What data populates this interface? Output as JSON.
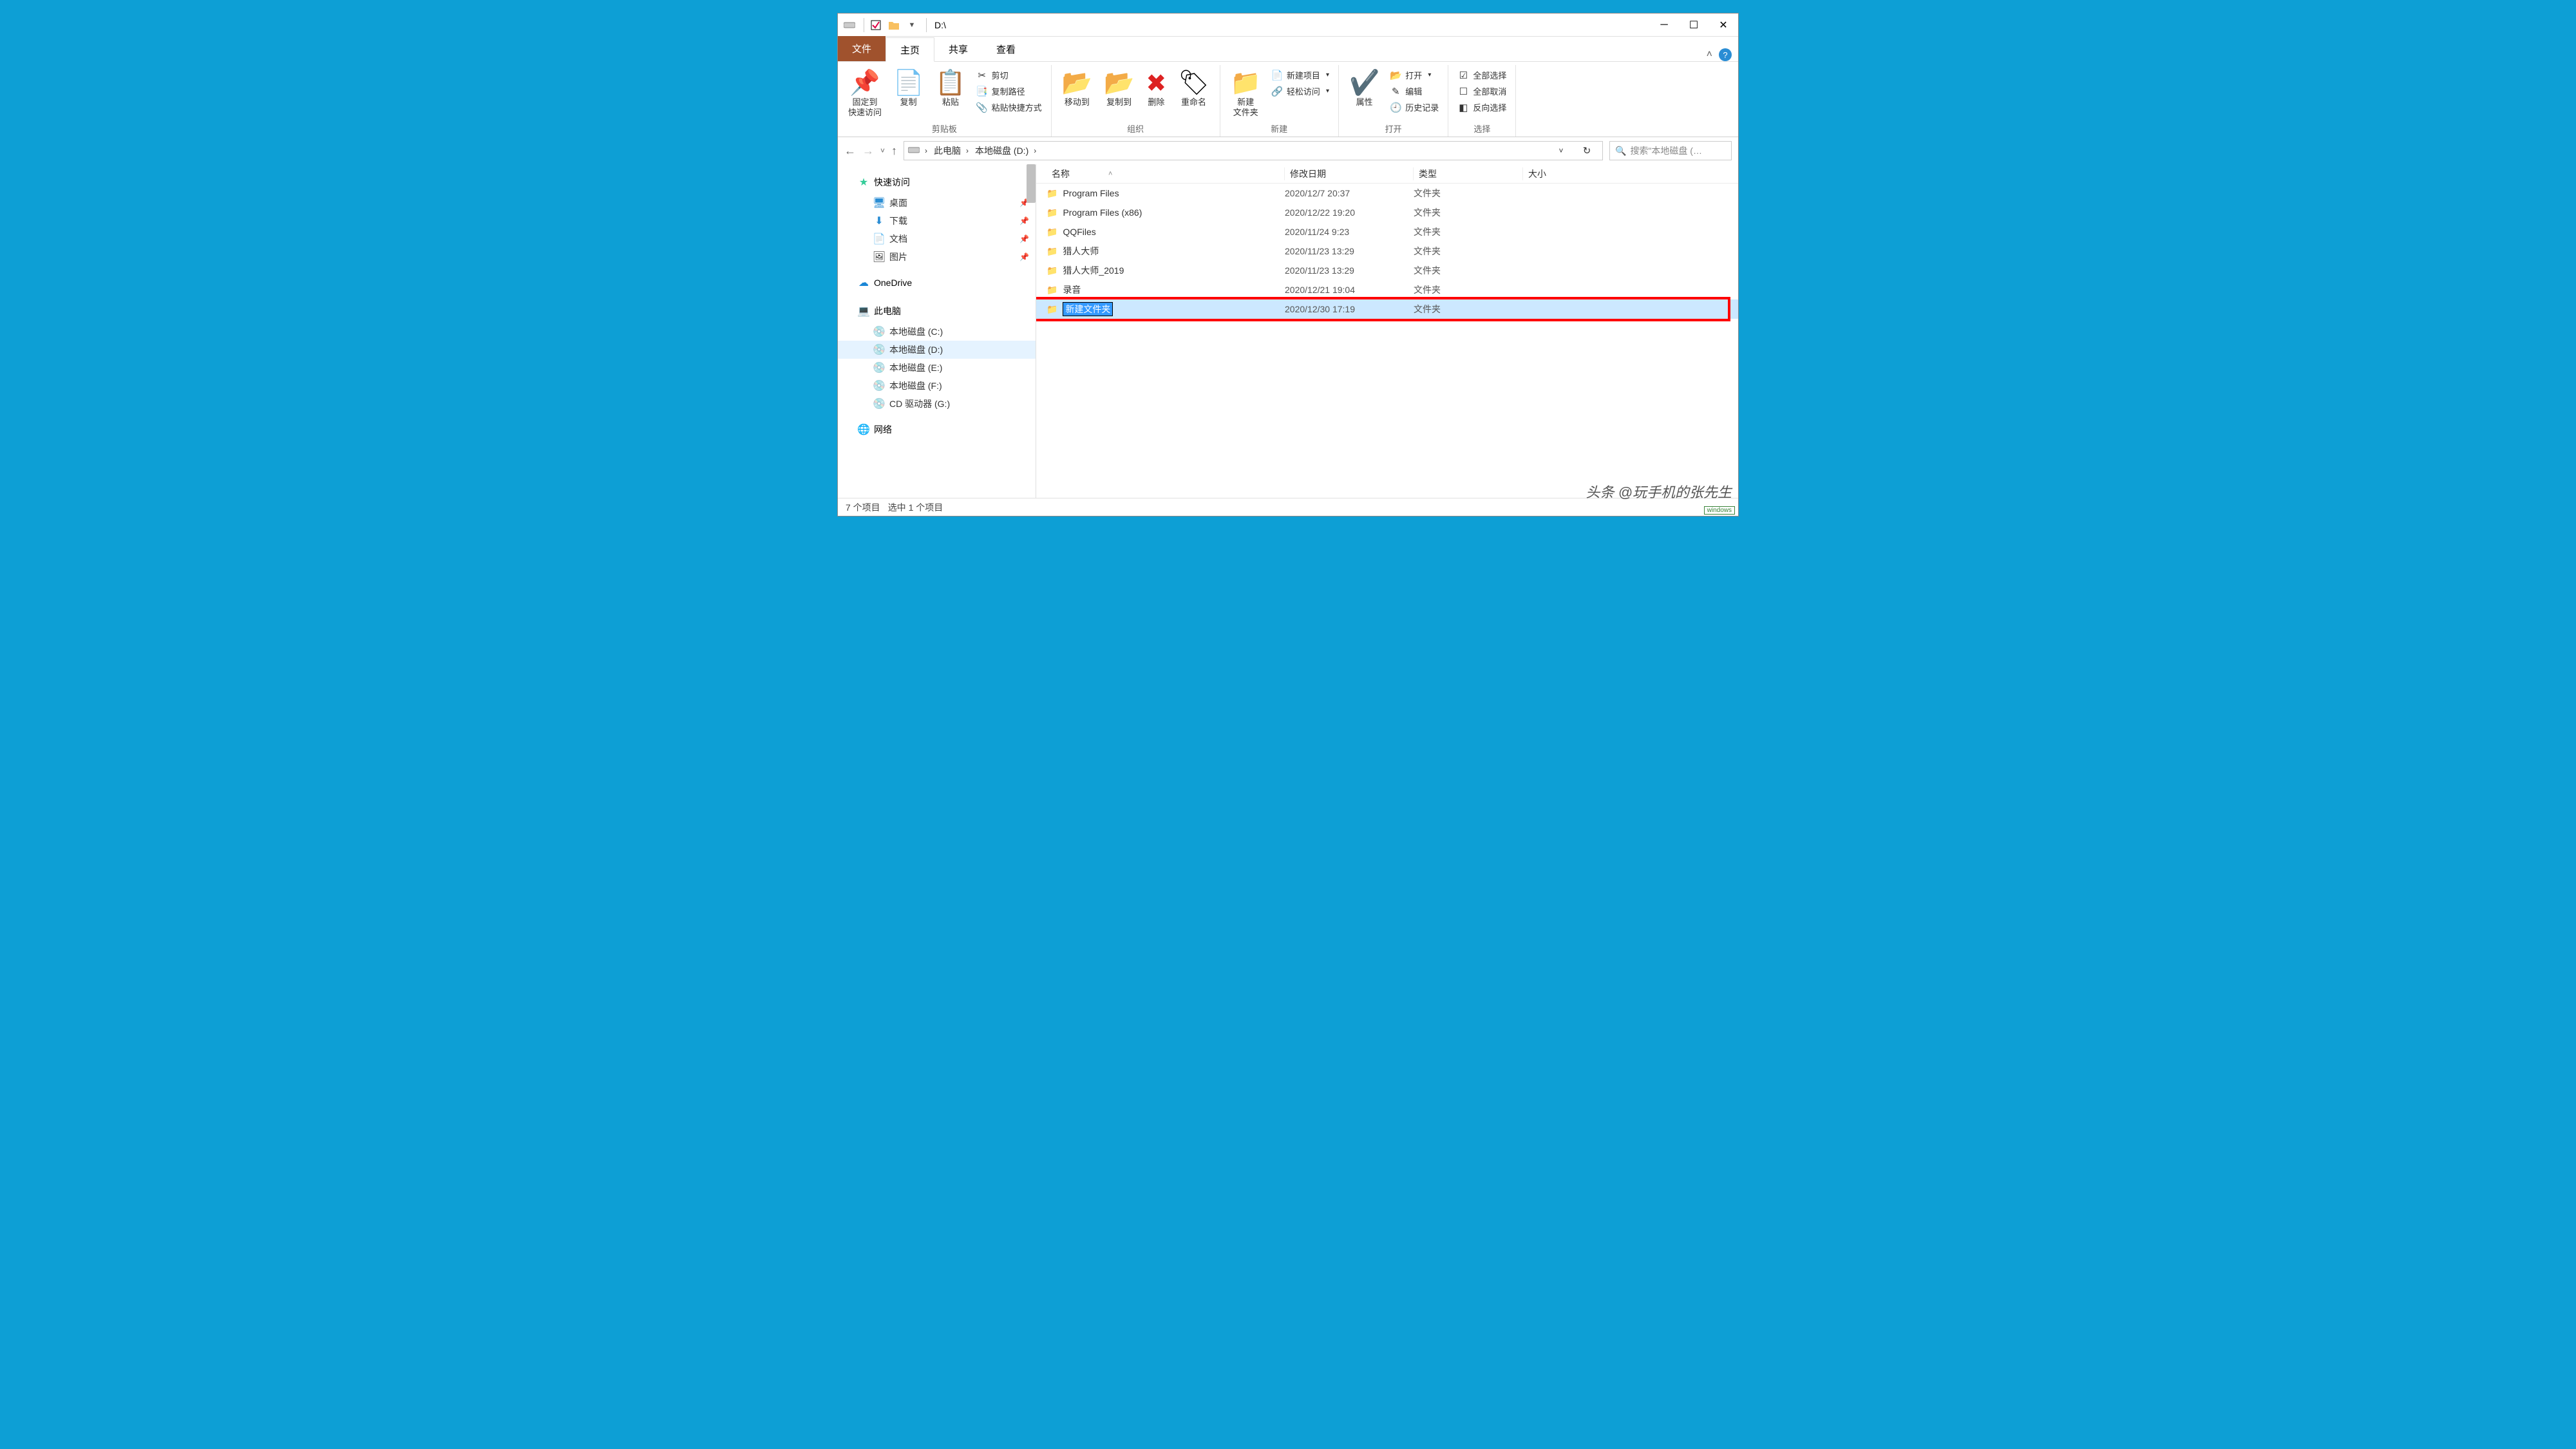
{
  "title": "D:\\",
  "tabs": {
    "file": "文件",
    "home": "主页",
    "share": "共享",
    "view": "查看"
  },
  "ribbon": {
    "clipboard": {
      "label": "剪贴板",
      "pin": "固定到\n快速访问",
      "copy": "复制",
      "paste": "粘贴",
      "cut": "剪切",
      "copypath": "复制路径",
      "pasteshortcut": "粘贴快捷方式"
    },
    "organize": {
      "label": "组织",
      "moveto": "移动到",
      "copyto": "复制到",
      "delete": "删除",
      "rename": "重命名"
    },
    "new": {
      "label": "新建",
      "newfolder": "新建\n文件夹",
      "newitem": "新建项目",
      "easyaccess": "轻松访问"
    },
    "open": {
      "label": "打开",
      "properties": "属性",
      "open": "打开",
      "edit": "编辑",
      "history": "历史记录"
    },
    "select": {
      "label": "选择",
      "all": "全部选择",
      "none": "全部取消",
      "invert": "反向选择"
    }
  },
  "breadcrumb": {
    "pc": "此电脑",
    "drive": "本地磁盘 (D:)"
  },
  "search_placeholder": "搜索\"本地磁盘 (…",
  "sidebar": {
    "quick": {
      "label": "快速访问",
      "items": [
        "桌面",
        "下载",
        "文档",
        "图片"
      ]
    },
    "onedrive": "OneDrive",
    "pc": {
      "label": "此电脑",
      "drives": [
        "本地磁盘 (C:)",
        "本地磁盘 (D:)",
        "本地磁盘 (E:)",
        "本地磁盘 (F:)",
        "CD 驱动器 (G:)"
      ],
      "network": "网络"
    }
  },
  "columns": {
    "name": "名称",
    "date": "修改日期",
    "type": "类型",
    "size": "大小"
  },
  "files": [
    {
      "name": "Program Files",
      "date": "2020/12/7 20:37",
      "type": "文件夹",
      "selected": false,
      "editing": false
    },
    {
      "name": "Program Files (x86)",
      "date": "2020/12/22 19:20",
      "type": "文件夹",
      "selected": false,
      "editing": false
    },
    {
      "name": "QQFiles",
      "date": "2020/11/24 9:23",
      "type": "文件夹",
      "selected": false,
      "editing": false
    },
    {
      "name": "猎人大师",
      "date": "2020/11/23 13:29",
      "type": "文件夹",
      "selected": false,
      "editing": false
    },
    {
      "name": "猎人大师_2019",
      "date": "2020/11/23 13:29",
      "type": "文件夹",
      "selected": false,
      "editing": false
    },
    {
      "name": "录音",
      "date": "2020/12/21 19:04",
      "type": "文件夹",
      "selected": false,
      "editing": false
    },
    {
      "name": "新建文件夹",
      "date": "2020/12/30 17:19",
      "type": "文件夹",
      "selected": true,
      "editing": true
    }
  ],
  "status": {
    "items": "7 个项目",
    "selected": "选中 1 个项目"
  },
  "watermark": "头条 @玩手机的张先生"
}
